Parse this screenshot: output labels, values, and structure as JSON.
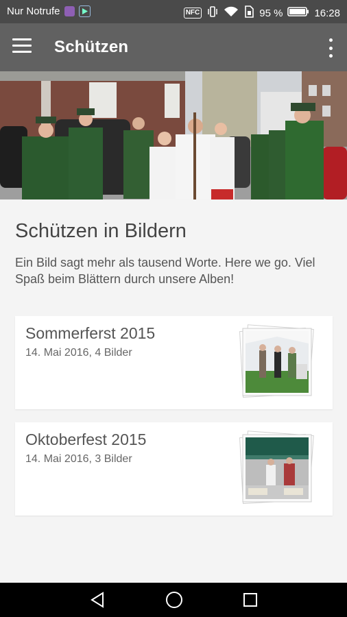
{
  "status_bar": {
    "carrier": "Nur Notrufe",
    "nfc": "NFC",
    "battery_percent": "95 %",
    "time": "16:28"
  },
  "app_bar": {
    "title": "Schützen",
    "menu_icon": "menu-icon",
    "overflow_icon": "more-vert-icon"
  },
  "main": {
    "heading": "Schützen in Bildern",
    "intro": "Ein Bild sagt mehr als tausend Worte. Here we go. Viel Spaß beim Blättern durch unsere Alben!"
  },
  "albums": [
    {
      "title": "Sommerferst 2015",
      "subtitle": "14. Mai 2016, 4 Bilder"
    },
    {
      "title": "Oktoberfest 2015",
      "subtitle": "14. Mai 2016, 3 Bilder"
    }
  ],
  "nav_bar": {
    "back_icon": "back-icon",
    "home_icon": "home-icon",
    "recents_icon": "recents-icon"
  }
}
